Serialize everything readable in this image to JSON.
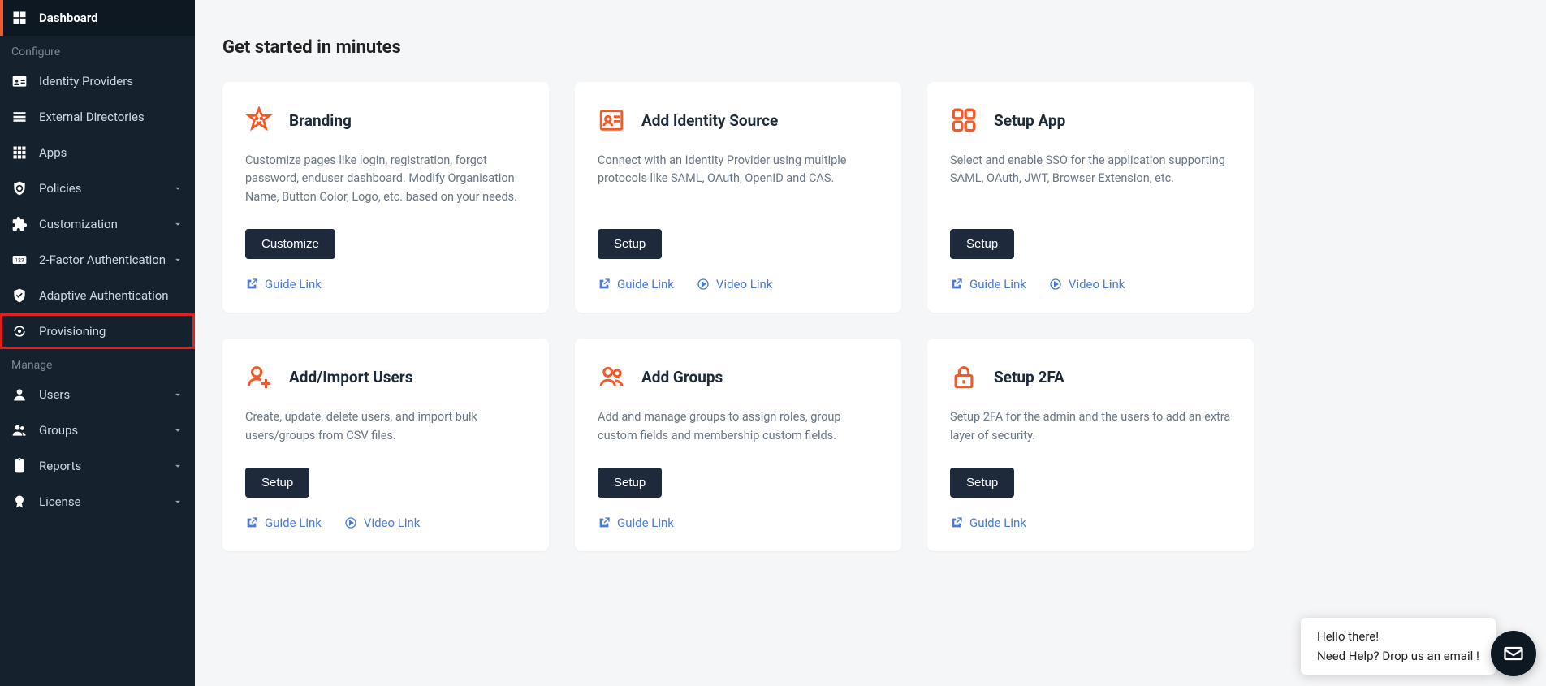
{
  "sidebar": {
    "sections": {
      "configure": "Configure",
      "manage": "Manage"
    },
    "items": {
      "dashboard": "Dashboard",
      "identity_providers": "Identity Providers",
      "external_directories": "External Directories",
      "apps": "Apps",
      "policies": "Policies",
      "customization": "Customization",
      "two_factor": "2-Factor Authentication",
      "adaptive_auth": "Adaptive Authentication",
      "provisioning": "Provisioning",
      "users": "Users",
      "groups": "Groups",
      "reports": "Reports",
      "license": "License"
    }
  },
  "main": {
    "title": "Get started in minutes",
    "cards": {
      "branding": {
        "title": "Branding",
        "desc": "Customize pages like login, registration, forgot password, enduser dashboard. Modify Organisation Name, Button Color, Logo, etc. based on your needs.",
        "button": "Customize",
        "guide": "Guide Link"
      },
      "identity_source": {
        "title": "Add Identity Source",
        "desc": "Connect with an Identity Provider using multiple protocols like SAML, OAuth, OpenID and CAS.",
        "button": "Setup",
        "guide": "Guide Link",
        "video": "Video Link"
      },
      "setup_app": {
        "title": "Setup App",
        "desc": "Select and enable SSO for the application supporting SAML, OAuth, JWT, Browser Extension, etc.",
        "button": "Setup",
        "guide": "Guide Link",
        "video": "Video Link"
      },
      "import_users": {
        "title": "Add/Import Users",
        "desc": "Create, update, delete users, and import bulk users/groups from CSV files.",
        "button": "Setup",
        "guide": "Guide Link",
        "video": "Video Link"
      },
      "add_groups": {
        "title": "Add Groups",
        "desc": "Add and manage groups to assign roles, group custom fields and membership custom fields.",
        "button": "Setup",
        "guide": "Guide Link"
      },
      "setup_2fa": {
        "title": "Setup 2FA",
        "desc": "Setup 2FA for the admin and the users to add an extra layer of security.",
        "button": "Setup",
        "guide": "Guide Link"
      }
    }
  },
  "chat": {
    "greeting": "Hello there!",
    "help": "Need Help? Drop us an email !"
  }
}
